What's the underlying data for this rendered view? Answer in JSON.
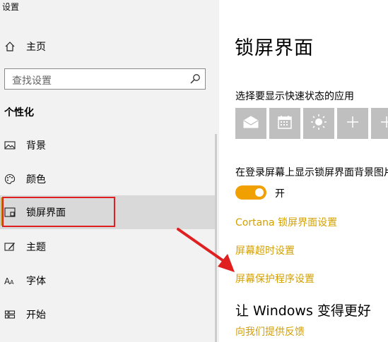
{
  "window": {
    "title": "设置"
  },
  "sidebar": {
    "home_label": "主页",
    "search_placeholder": "查找设置",
    "section_title": "个性化",
    "items": [
      {
        "label": "背景",
        "icon": "picture-icon"
      },
      {
        "label": "颜色",
        "icon": "palette-icon"
      },
      {
        "label": "锁屏界面",
        "icon": "lock-screen-icon",
        "active": true
      },
      {
        "label": "主题",
        "icon": "theme-icon"
      },
      {
        "label": "字体",
        "icon": "font-icon"
      },
      {
        "label": "开始",
        "icon": "start-icon"
      }
    ]
  },
  "main": {
    "title": "锁屏界面",
    "quick_status_label": "选择要显示快速状态的应用",
    "quick_status_apps": [
      "mail-icon",
      "calendar-icon",
      "weather-icon",
      "plus-icon",
      "plus-icon"
    ],
    "signin_background_label": "在登录屏幕上显示锁屏界面背景图片",
    "toggle_state": "开",
    "links": {
      "cortana": "Cortana 锁屏界面设置",
      "timeout": "屏幕超时设置",
      "screensaver": "屏幕保护程序设置"
    },
    "feedback_heading": "让 Windows 变得更好",
    "feedback_link": "向我们提供反馈"
  },
  "colors": {
    "accent": "#f0a000",
    "link": "#d4a000",
    "annotation": "#e02020"
  }
}
